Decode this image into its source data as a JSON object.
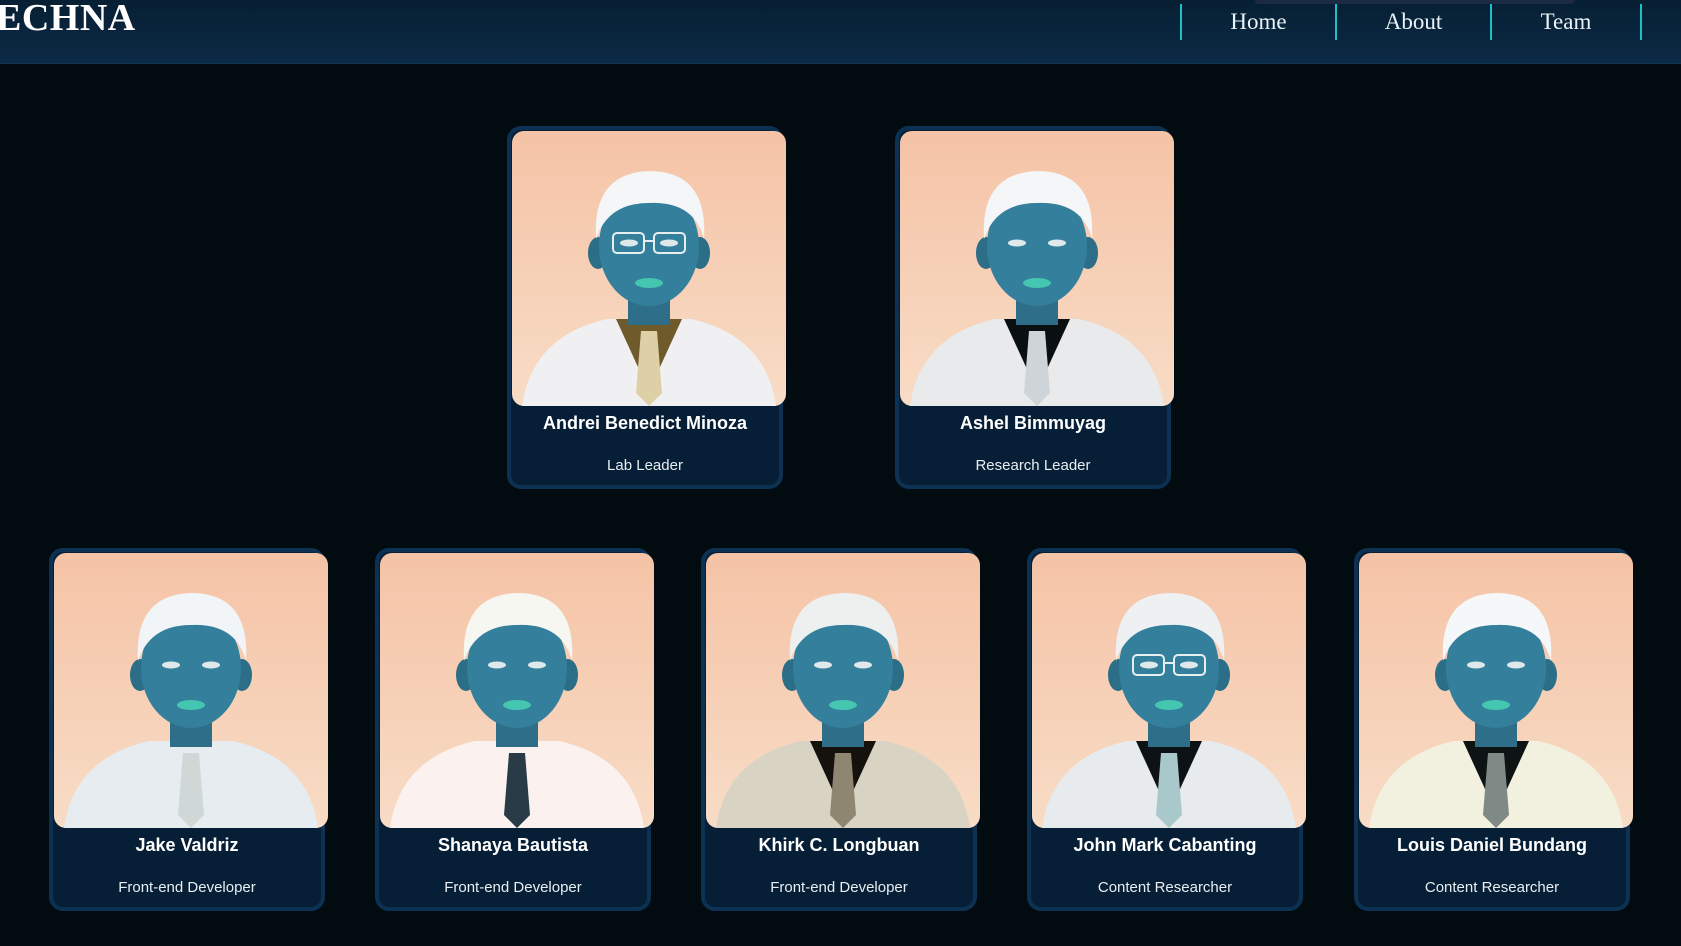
{
  "header": {
    "brand": "ECHNA",
    "nav": [
      {
        "label": "Home"
      },
      {
        "label": "About"
      },
      {
        "label": "Team"
      }
    ]
  },
  "team": {
    "members": [
      {
        "name": "Andrei Benedict Minoza",
        "role": "Lab Leader",
        "suit": "#f0f0f2",
        "shirt": "#6e5a2a",
        "tie": "#ded0a6",
        "hair": "#f4f6f8",
        "glasses": true
      },
      {
        "name": "Ashel Bimmuyag",
        "role": "Research Leader",
        "suit": "#e9eaec",
        "shirt": "#0a0f12",
        "tie": "#cfd4d8",
        "hair": "#f4f6f8",
        "glasses": false
      },
      {
        "name": "Jake Valdriz",
        "role": "Front-end Developer",
        "suit": "#e6ecf0",
        "shirt": "#e6ecf0",
        "tie": "#cfd8d6",
        "hair": "#f2f5f7",
        "glasses": false
      },
      {
        "name": "Shanaya Bautista",
        "role": "Front-end Developer",
        "suit": "#fbf2ef",
        "shirt": "#fbf2ef",
        "tie": "#2a3b48",
        "hair": "#f6f7f1",
        "glasses": false
      },
      {
        "name": "Khirk C. Longbuan",
        "role": "Front-end Developer",
        "suit": "#d9d3c4",
        "shirt": "#15120d",
        "tie": "#8e8670",
        "hair": "#eef0f0",
        "glasses": false
      },
      {
        "name": "John Mark Cabanting",
        "role": "Content Researcher",
        "suit": "#e7ebee",
        "shirt": "#0d1216",
        "tie": "#a8c8cc",
        "hair": "#eef0f2",
        "glasses": true
      },
      {
        "name": "Louis Daniel Bundang",
        "role": "Content Researcher",
        "suit": "#f2f0df",
        "shirt": "#0e1413",
        "tie": "#7f8a86",
        "hair": "#f5f7f8",
        "glasses": false
      }
    ]
  }
}
